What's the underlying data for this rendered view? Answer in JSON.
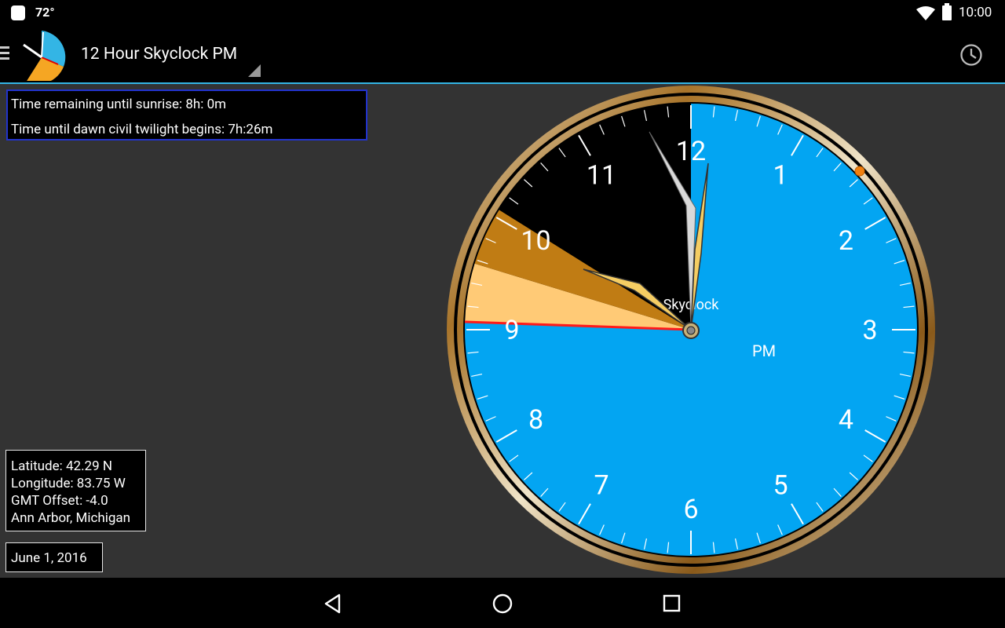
{
  "status_bar": {
    "temperature": "72°",
    "time": "10:00"
  },
  "app_bar": {
    "title": "12 Hour Skyclock PM"
  },
  "info": {
    "sunrise_line": "Time remaining until sunrise:  8h: 0m",
    "twilight_line": "Time until dawn civil twilight begins:  7h:26m"
  },
  "location": {
    "latitude": "Latitude: 42.29 N",
    "longitude": "Longitude: 83.75 W",
    "gmt_offset": "GMT Offset: -4.0",
    "place": "Ann Arbor, Michigan"
  },
  "date": {
    "label": "June  1, 2016"
  },
  "clock": {
    "brand": "Skyclock",
    "period": "PM",
    "hours": [
      "12",
      "1",
      "2",
      "3",
      "4",
      "5",
      "6",
      "7",
      "8",
      "9",
      "10",
      "11"
    ],
    "time": "10:00",
    "colors": {
      "day": "#03a5f2",
      "night": "#000000",
      "twilight_dark": "#c07c14",
      "twilight_light": "#ffca76",
      "sunrise_line": "#ff1a1a",
      "hand_fill": "#f5cd63"
    }
  }
}
